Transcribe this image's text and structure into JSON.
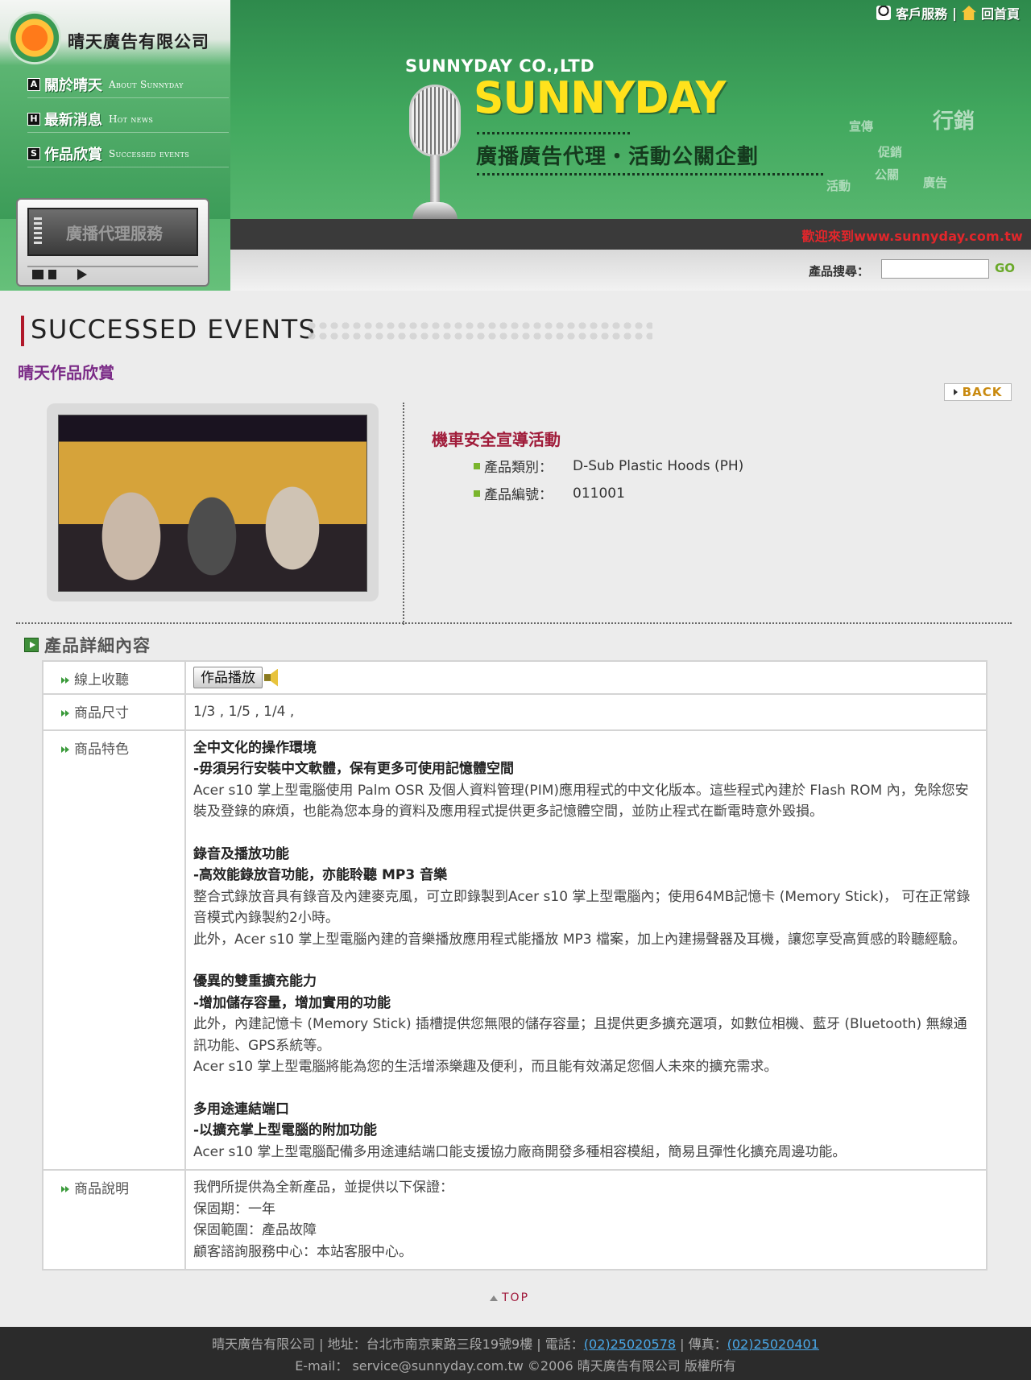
{
  "header": {
    "company_name": "晴天廣告有限公司",
    "top_links": {
      "customer_service": "客戶服務",
      "separator": "|",
      "home": "回首頁"
    },
    "nav": [
      {
        "badge": "A",
        "label_zh": "關於晴天",
        "label_en": "About Sunnyday"
      },
      {
        "badge": "H",
        "label_zh": "最新消息",
        "label_en": "Hot news"
      },
      {
        "badge": "S",
        "label_zh": "作品欣賞",
        "label_en": "Successed events"
      }
    ],
    "player_label": "廣播代理服務",
    "brand_company": "SUNNYDAY CO.,LTD",
    "brand_name": "SUNNYDAY",
    "brand_tagline": "廣播廣告代理・活動公關企劃",
    "deco_words": [
      "行銷",
      "宣傳",
      "促銷",
      "公關",
      "廣告",
      "活動"
    ],
    "welcome": "歡迎來到www.sunnyday.com.tw",
    "search": {
      "label": "產品搜尋：",
      "value": "",
      "go": "GO"
    }
  },
  "page": {
    "title": "SUCCESSED EVENTS",
    "subtitle": "晴天作品欣賞",
    "back": "BACK"
  },
  "item": {
    "title": "機車安全宣導活動",
    "specs": [
      {
        "label": "產品類別：",
        "value": "D-Sub Plastic Hoods (PH)"
      },
      {
        "label": "產品編號：",
        "value": "011001"
      }
    ]
  },
  "details": {
    "heading": "產品詳細內容",
    "rows": {
      "listen": {
        "label": "線上收聽",
        "button": "作品播放"
      },
      "size": {
        "label": "商品尺寸",
        "value": "1/3 , 1/5 , 1/4 ,"
      },
      "features": {
        "label": "商品特色",
        "blocks": [
          {
            "title": "全中文化的操作環境",
            "subtitle": "-毋須另行安裝中文軟體，保有更多可使用記憶體空間",
            "paras": [
              "Acer s10 掌上型電腦使用 Palm OSR 及個人資料管理(PIM)應用程式的中文化版本。這些程式內建於 Flash ROM 內，免除您安裝及登錄的麻煩，也能為您本身的資料及應用程式提供更多記憶體空間，並防止程式在斷電時意外毀損。"
            ]
          },
          {
            "title": "錄音及播放功能",
            "subtitle": "-高效能錄放音功能，亦能聆聽 MP3 音樂",
            "paras": [
              "整合式錄放音具有錄音及內建麥克風，可立即錄製到Acer s10 掌上型電腦內；使用64MB記憶卡 (Memory Stick)， 可在正常錄音模式內錄製約2小時。",
              "此外，Acer s10 掌上型電腦內建的音樂播放應用程式能播放 MP3 檔案，加上內建揚聲器及耳機，讓您享受高質感的聆聽經驗。"
            ]
          },
          {
            "title": "優異的雙重擴充能力",
            "subtitle": "-增加儲存容量，增加實用的功能",
            "paras": [
              "此外，內建記憶卡 (Memory Stick) 插槽提供您無限的儲存容量；且提供更多擴充選項，如數位相機、藍牙 (Bluetooth) 無線通訊功能、GPS系統等。",
              "Acer s10 掌上型電腦將能為您的生活增添樂趣及便利，而且能有效滿足您個人未來的擴充需求。"
            ]
          },
          {
            "title": "多用途連結端口",
            "subtitle": "-以擴充掌上型電腦的附加功能",
            "paras": [
              "Acer s10 掌上型電腦配備多用途連結端口能支援協力廠商開發多種相容模組，簡易且彈性化擴充周邊功能。"
            ]
          }
        ]
      },
      "description": {
        "label": "商品說明",
        "lines": [
          "我們所提供為全新產品，並提供以下保證：",
          "保固期：一年",
          "保固範圍：產品故障",
          "顧客諮詢服務中心：本站客服中心。"
        ]
      }
    }
  },
  "top_link": "TOP",
  "footer": {
    "prefix": "晴天廣告有限公司 | 地址：台北市南京東路三段19號9樓 | 電話：",
    "phone": "(02)25020578",
    "fax_label": " | 傳真：",
    "fax": "(02)25020401",
    "line2": "E-mail： service@sunnyday.com.tw ©2006 晴天廣告有限公司 版權所有"
  },
  "colors": {
    "accent_red": "#b0182a",
    "subtitle_purple": "#7a2a86",
    "item_title": "#a01c3a",
    "bullet_green": "#7ab52d",
    "welcome_red": "#e3262b"
  }
}
